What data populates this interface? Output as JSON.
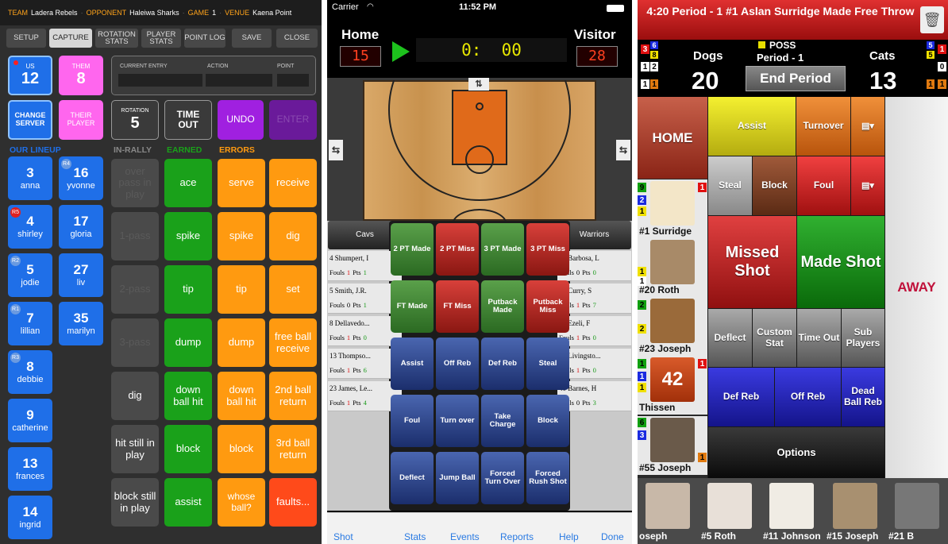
{
  "volleyball": {
    "header": {
      "team_k": "TEAM",
      "team_v": "Ladera Rebels",
      "opp_k": "OPPONENT",
      "opp_v": "Haleiwa Sharks",
      "game_k": "GAME",
      "game_v": "1",
      "venue_k": "VENUE",
      "venue_v": "Kaena Point"
    },
    "tabs": [
      "SETUP",
      "CAPTURE",
      "ROTATION STATS",
      "PLAYER STATS",
      "POINT LOG",
      "SAVE",
      "CLOSE"
    ],
    "us": {
      "label": "US",
      "score": "12"
    },
    "them": {
      "label": "THEM",
      "score": "8"
    },
    "entry": {
      "current": "CURRENT ENTRY",
      "action": "ACTION",
      "point": "POINT"
    },
    "change_server": "CHANGE SERVER",
    "their_player": "THEIR PLAYER",
    "rotation": {
      "label": "ROTATION",
      "value": "5"
    },
    "timeout": "TIME OUT",
    "undo": "UNDO",
    "enter": "ENTER",
    "sections": {
      "lineup": "OUR LINEUP",
      "inrally": "IN-RALLY",
      "earned": "EARNED",
      "errors": "ERRORS"
    },
    "players_left": [
      {
        "num": "3",
        "name": "anna",
        "badge": ""
      },
      {
        "num": "4",
        "name": "shirley",
        "badge": "R5"
      },
      {
        "num": "5",
        "name": "jodie",
        "badge": "R2"
      },
      {
        "num": "7",
        "name": "lillian",
        "badge": "R1"
      },
      {
        "num": "8",
        "name": "debbie",
        "badge": "R3"
      },
      {
        "num": "9",
        "name": "catherine",
        "badge": ""
      },
      {
        "num": "13",
        "name": "frances",
        "badge": ""
      },
      {
        "num": "14",
        "name": "ingrid",
        "badge": ""
      }
    ],
    "players_right": [
      {
        "num": "16",
        "name": "yvonne",
        "badge": "R4"
      },
      {
        "num": "17",
        "name": "gloria",
        "badge": ""
      },
      {
        "num": "27",
        "name": "liv",
        "badge": ""
      },
      {
        "num": "35",
        "name": "marilyn",
        "badge": ""
      }
    ],
    "inrally": [
      "over pass in play",
      "1-pass",
      "2-pass",
      "3-pass",
      "dig",
      "hit still in play",
      "block still in play"
    ],
    "earned": [
      "ace",
      "spike",
      "tip",
      "dump",
      "down ball hit",
      "block",
      "assist"
    ],
    "errors_a": [
      "serve",
      "spike",
      "tip",
      "dump",
      "down ball hit",
      "block",
      "whose ball?"
    ],
    "errors_b": [
      "receive",
      "dig",
      "set",
      "free ball receive",
      "2nd ball return",
      "3rd ball return",
      "faults..."
    ]
  },
  "basketball": {
    "status": {
      "carrier": "Carrier",
      "time": "11:52 PM"
    },
    "home": {
      "label": "Home",
      "score": "15"
    },
    "visitor": {
      "label": "Visitor",
      "score": "28"
    },
    "clock": "0:  00",
    "home_team": "Cavs",
    "away_team": "Warriors",
    "home_roster": [
      {
        "name": "4 Shumpert, I",
        "fouls": "1",
        "pts": "1"
      },
      {
        "name": "5 Smith, J.R.",
        "fouls": "0",
        "pts": "1"
      },
      {
        "name": "8 Dellavedo...",
        "fouls": "1",
        "pts": "0"
      },
      {
        "name": "13 Thompso...",
        "fouls": "1",
        "pts": "6"
      },
      {
        "name": "23 James, Le...",
        "fouls": "1",
        "pts": "4"
      }
    ],
    "away_roster": [
      {
        "name": "19 Barbosa, L",
        "fouls": "0",
        "pts": "0"
      },
      {
        "name": "30 Curry, S",
        "fouls": "1",
        "pts": "7"
      },
      {
        "name": "31 Ezeli, F",
        "fouls": "1",
        "pts": "0"
      },
      {
        "name": "34 Livingsto...",
        "fouls": "1",
        "pts": "0"
      },
      {
        "name": "40 Barnes, H",
        "fouls": "0",
        "pts": "3"
      }
    ],
    "fouls_label": "Fouls",
    "pts_label": "Pts",
    "actions": [
      {
        "l": "2 PT Made",
        "c": "g"
      },
      {
        "l": "2 PT Miss",
        "c": "r"
      },
      {
        "l": "3 PT Made",
        "c": "g"
      },
      {
        "l": "3 PT Miss",
        "c": "r"
      },
      {
        "l": "FT Made",
        "c": "g"
      },
      {
        "l": "FT Miss",
        "c": "r"
      },
      {
        "l": "Putback Made",
        "c": "g"
      },
      {
        "l": "Putback Miss",
        "c": "r"
      },
      {
        "l": "Assist",
        "c": "b"
      },
      {
        "l": "Off Reb",
        "c": "b"
      },
      {
        "l": "Def Reb",
        "c": "b"
      },
      {
        "l": "Steal",
        "c": "b"
      },
      {
        "l": "Foul",
        "c": "b"
      },
      {
        "l": "Turn over",
        "c": "b"
      },
      {
        "l": "Take Charge",
        "c": "b"
      },
      {
        "l": "Block",
        "c": "b"
      },
      {
        "l": "Deflect",
        "c": "b"
      },
      {
        "l": "Jump Ball",
        "c": "b"
      },
      {
        "l": "Forced Turn Over",
        "c": "b"
      },
      {
        "l": "Forced Rush Shot",
        "c": "b"
      }
    ],
    "footer": [
      "Shot Chart",
      "Stats",
      "Events",
      "Reports",
      "Help",
      "Done"
    ]
  },
  "tracker": {
    "banner": "4:20 Period - 1  #1 Aslan Surridge Made Free Throw",
    "poss": "POSS",
    "period": "Period - 1",
    "home_team": "Dogs",
    "home_score": "20",
    "away_team": "Cats",
    "away_score": "13",
    "end_period": "End Period",
    "home": "HOME",
    "away": "AWAY",
    "buttons": {
      "assist": "Assist",
      "turnover": "Turnover",
      "steal": "Steal",
      "block": "Block",
      "foul": "Foul",
      "missed": "Missed Shot",
      "made": "Made Shot",
      "deflect": "Deflect",
      "custom": "Custom Stat",
      "timeout": "Time Out",
      "sub": "Sub Players",
      "defreb": "Def Reb",
      "offreb": "Off Reb",
      "deadball": "Dead Ball Reb",
      "options": "Options"
    },
    "players": [
      "#1 Surridge",
      "#20 Roth",
      "#23 Joseph",
      "Thissen",
      "#55 Joseph"
    ],
    "thissen_num": "42",
    "bench": [
      "oseph",
      "#5 Roth",
      "#11 Johnson",
      "#15 Joseph",
      "#21 B"
    ],
    "colors": {
      "red": "#e01010",
      "green": "#10a010",
      "yellow": "#e8e000",
      "blue": "#1a2ae0"
    }
  }
}
